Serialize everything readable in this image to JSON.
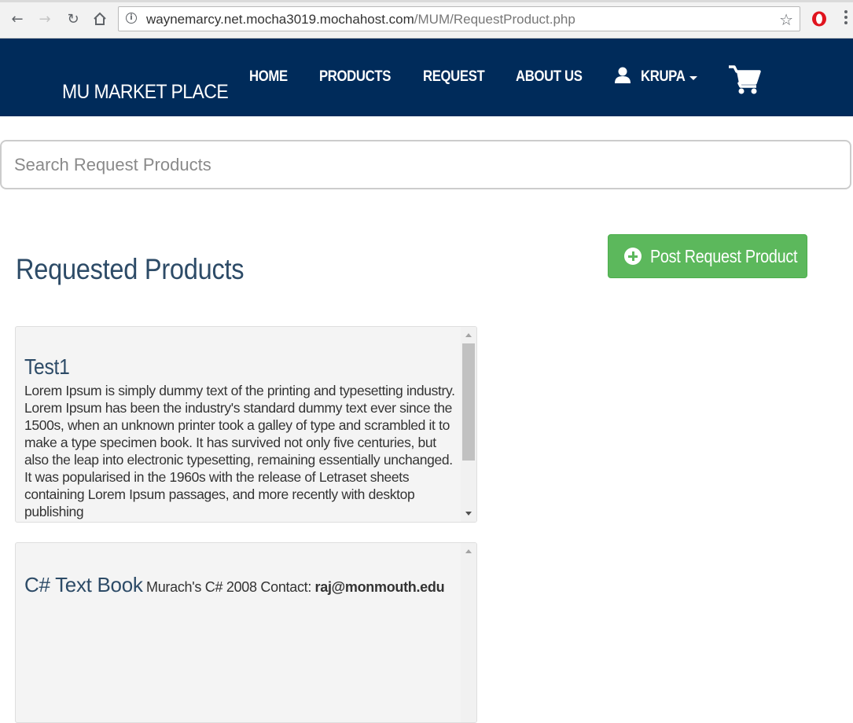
{
  "browser": {
    "url_host": "waynemarcy.net.mocha3019.mochahost.com",
    "url_path": "/MUM/RequestProduct.php",
    "icons": {
      "back": "back-arrow-icon",
      "forward": "forward-arrow-icon",
      "reload": "reload-icon",
      "home": "home-icon",
      "info": "info-icon",
      "bookmark": "star-icon",
      "extension": "opera-icon",
      "menu": "kebab-menu-icon"
    }
  },
  "navbar": {
    "brand": "MU MARKET PLACE",
    "links": [
      "HOME",
      "PRODUCTS",
      "REQUEST",
      "ABOUT US"
    ],
    "user": "KRUPA",
    "background_color": "#002b5a"
  },
  "search": {
    "placeholder": "Search Request Products"
  },
  "main": {
    "title": "Requested Products",
    "post_button": "Post Request Product",
    "post_button_color": "#5cb85c"
  },
  "requests": [
    {
      "title": "Test1",
      "body": "Lorem Ipsum is simply dummy text of the printing and typesetting industry. Lorem Ipsum has been the industry's standard dummy text ever since the 1500s, when an unknown printer took a galley of type and scrambled it to make a type specimen book. It has survived not only five centuries, but also the leap into electronic typesetting, remaining essentially unchanged. It was popularised in the 1960s with the release of Letraset sheets containing Lorem Ipsum passages, and more recently with desktop publishing"
    },
    {
      "title": "C# Text Book",
      "description": "Murach's C# 2008 Contact:",
      "contact": "raj@monmouth.edu"
    }
  ]
}
